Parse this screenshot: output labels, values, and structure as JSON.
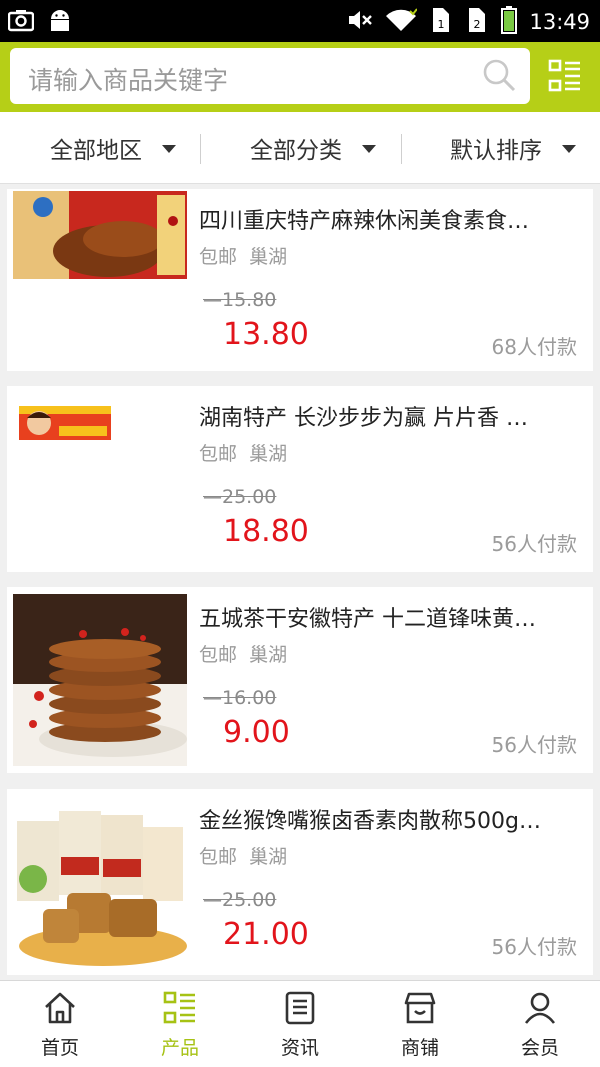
{
  "status_bar": {
    "time": "13:49"
  },
  "search": {
    "placeholder": "请输入商品关键字"
  },
  "filters": [
    {
      "label": "全部地区"
    },
    {
      "label": "全部分类"
    },
    {
      "label": "默认排序"
    }
  ],
  "products": [
    {
      "title": "四川重庆特产麻辣休闲美食素食…",
      "tag_shipping": "包邮",
      "tag_location": "巢湖",
      "original_price": "15.80",
      "price": "13.80",
      "sold": "68人付款"
    },
    {
      "title": "湖南特产 长沙步步为赢 片片香 …",
      "tag_shipping": "包邮",
      "tag_location": "巢湖",
      "original_price": "25.00",
      "price": "18.80",
      "sold": "56人付款"
    },
    {
      "title": "五城茶干安徽特产 十二道锋味黄…",
      "tag_shipping": "包邮",
      "tag_location": "巢湖",
      "original_price": "16.00",
      "price": "9.00",
      "sold": "56人付款"
    },
    {
      "title": "金丝猴馋嘴猴卤香素肉散称500g…",
      "tag_shipping": "包邮",
      "tag_location": "巢湖",
      "original_price": "25.00",
      "price": "21.00",
      "sold": "56人付款"
    }
  ],
  "bottom_nav": [
    {
      "label": "首页",
      "icon": "home-icon"
    },
    {
      "label": "产品",
      "icon": "products-icon",
      "active": true
    },
    {
      "label": "资讯",
      "icon": "news-icon"
    },
    {
      "label": "商铺",
      "icon": "shop-icon"
    },
    {
      "label": "会员",
      "icon": "member-icon"
    }
  ],
  "colors": {
    "accent": "#b6cf17",
    "price": "#e2141b",
    "nav_active": "#a6c214"
  }
}
